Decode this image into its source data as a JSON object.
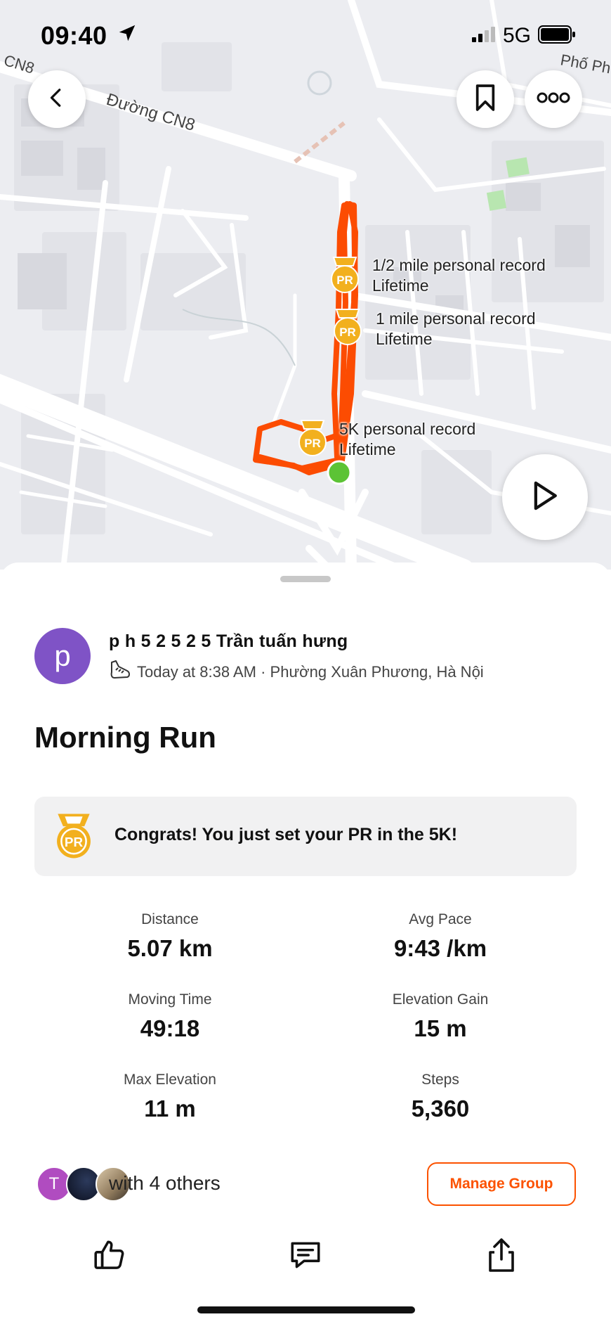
{
  "status_bar": {
    "time": "09:40",
    "network": "5G"
  },
  "map": {
    "street_labels": [
      "Đường CN8",
      "CN8",
      "Phố Ph"
    ],
    "pr_markers": [
      {
        "label_line1": "1/2 mile personal record",
        "label_line2": "Lifetime",
        "badge_text": "PR"
      },
      {
        "label_line1": "1 mile personal record",
        "label_line2": "Lifetime",
        "badge_text": "PR"
      },
      {
        "label_line1": "5K personal record",
        "label_line2": "Lifetime",
        "badge_text": "PR"
      }
    ]
  },
  "activity": {
    "avatar_initial": "p",
    "athlete_name": "p h 5 2 5 2 5 Trần tuấn hưng",
    "meta": "Today at 8:38 AM · Phường Xuân Phương, Hà Nội",
    "title": "Morning Run",
    "congrats": "Congrats! You just set your PR in the 5K!",
    "congrats_badge_text": "PR"
  },
  "stats": [
    {
      "label": "Distance",
      "value": "5.07 km"
    },
    {
      "label": "Avg Pace",
      "value": "9:43 /km"
    },
    {
      "label": "Moving Time",
      "value": "49:18"
    },
    {
      "label": "Elevation Gain",
      "value": "15 m"
    },
    {
      "label": "Max Elevation",
      "value": "11 m"
    },
    {
      "label": "Steps",
      "value": "5,360"
    }
  ],
  "group": {
    "first_avatar_initial": "T",
    "with_text": "with 4 others",
    "manage_label": "Manage Group"
  },
  "colors": {
    "accent": "#fc5200",
    "route": "#fc4c02",
    "pr_gold": "#f2b01e",
    "avatar": "#7f53c6",
    "start_dot": "#5cc335"
  },
  "icons": [
    "back-arrow-icon",
    "bookmark-icon",
    "more-icon",
    "play-icon",
    "shoe-icon",
    "pr-medal-icon",
    "thumbs-up-icon",
    "comment-icon",
    "share-icon",
    "location-arrow-icon",
    "signal-icon",
    "battery-icon"
  ]
}
